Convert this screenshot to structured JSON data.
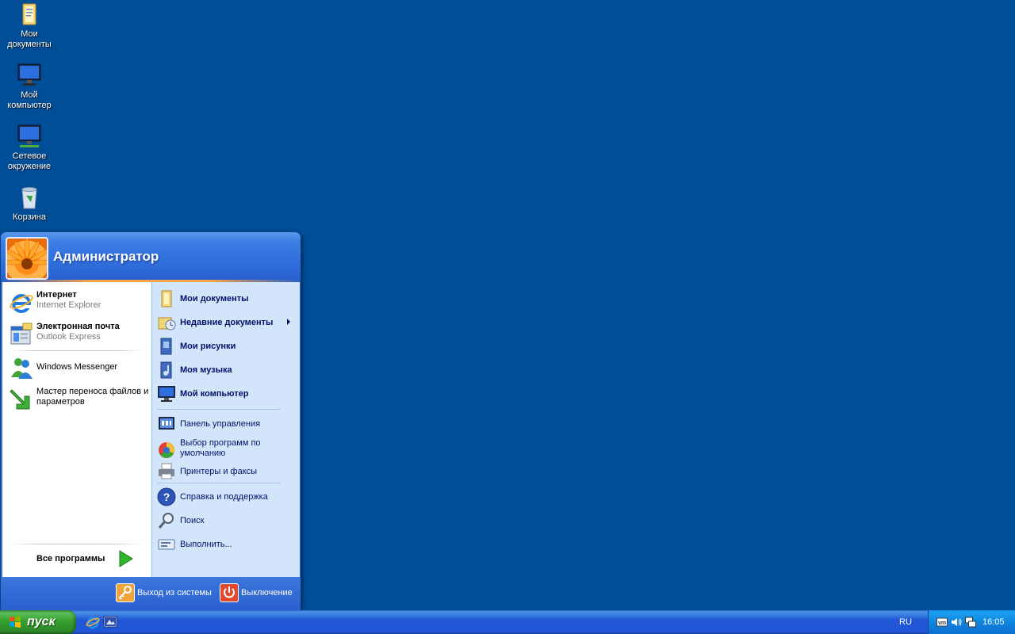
{
  "desktop": {
    "icons": [
      {
        "label_line1": "Мои",
        "label_line2": "документы",
        "icon": "my-documents-icon"
      },
      {
        "label_line1": "Мой",
        "label_line2": "компьютер",
        "icon": "my-computer-icon"
      },
      {
        "label_line1": "Сетевое",
        "label_line2": "окружение",
        "icon": "network-places-icon"
      },
      {
        "label_line1": "Корзина",
        "label_line2": "",
        "icon": "recycle-bin-icon"
      }
    ],
    "background_color": "#004e98"
  },
  "start_menu": {
    "user": "Администратор",
    "pinned": [
      {
        "name": "Интернет",
        "sub": "Internet Explorer",
        "icon": "internet-explorer-icon"
      },
      {
        "name": "Электронная почта",
        "sub": "Outlook Express",
        "icon": "outlook-express-icon"
      }
    ],
    "recent": [
      {
        "name": "Windows Messenger",
        "icon": "messenger-icon"
      },
      {
        "name": "Мастер переноса файлов и параметров",
        "icon": "transfer-wizard-icon"
      }
    ],
    "all_programs": "Все программы",
    "places": [
      {
        "label": "Мои документы",
        "icon": "my-documents-icon"
      },
      {
        "label": "Недавние документы",
        "icon": "recent-documents-icon"
      },
      {
        "label": "Мои рисунки",
        "icon": "my-pictures-icon"
      },
      {
        "label": "Моя музыка",
        "icon": "my-music-icon"
      },
      {
        "label": "Мой компьютер",
        "icon": "my-computer-icon"
      }
    ],
    "settings": [
      {
        "label": "Панель управления",
        "icon": "control-panel-icon"
      },
      {
        "label": "Выбор программ по умолчанию",
        "icon": "default-programs-icon"
      },
      {
        "label": "Принтеры и факсы",
        "icon": "printers-icon"
      }
    ],
    "tools": [
      {
        "label": "Справка и поддержка",
        "icon": "help-icon"
      },
      {
        "label": "Поиск",
        "icon": "search-icon"
      },
      {
        "label": "Выполнить...",
        "icon": "run-icon"
      }
    ],
    "logoff": "Выход из системы",
    "shutdown": "Выключение"
  },
  "taskbar": {
    "start_label": "пуск",
    "quick_launch": [
      "internet-explorer-icon",
      "show-desktop-icon"
    ],
    "language": "RU",
    "clock": "16:05",
    "tray_icons": [
      "vmware-icon",
      "volume-icon",
      "network-icon"
    ]
  }
}
